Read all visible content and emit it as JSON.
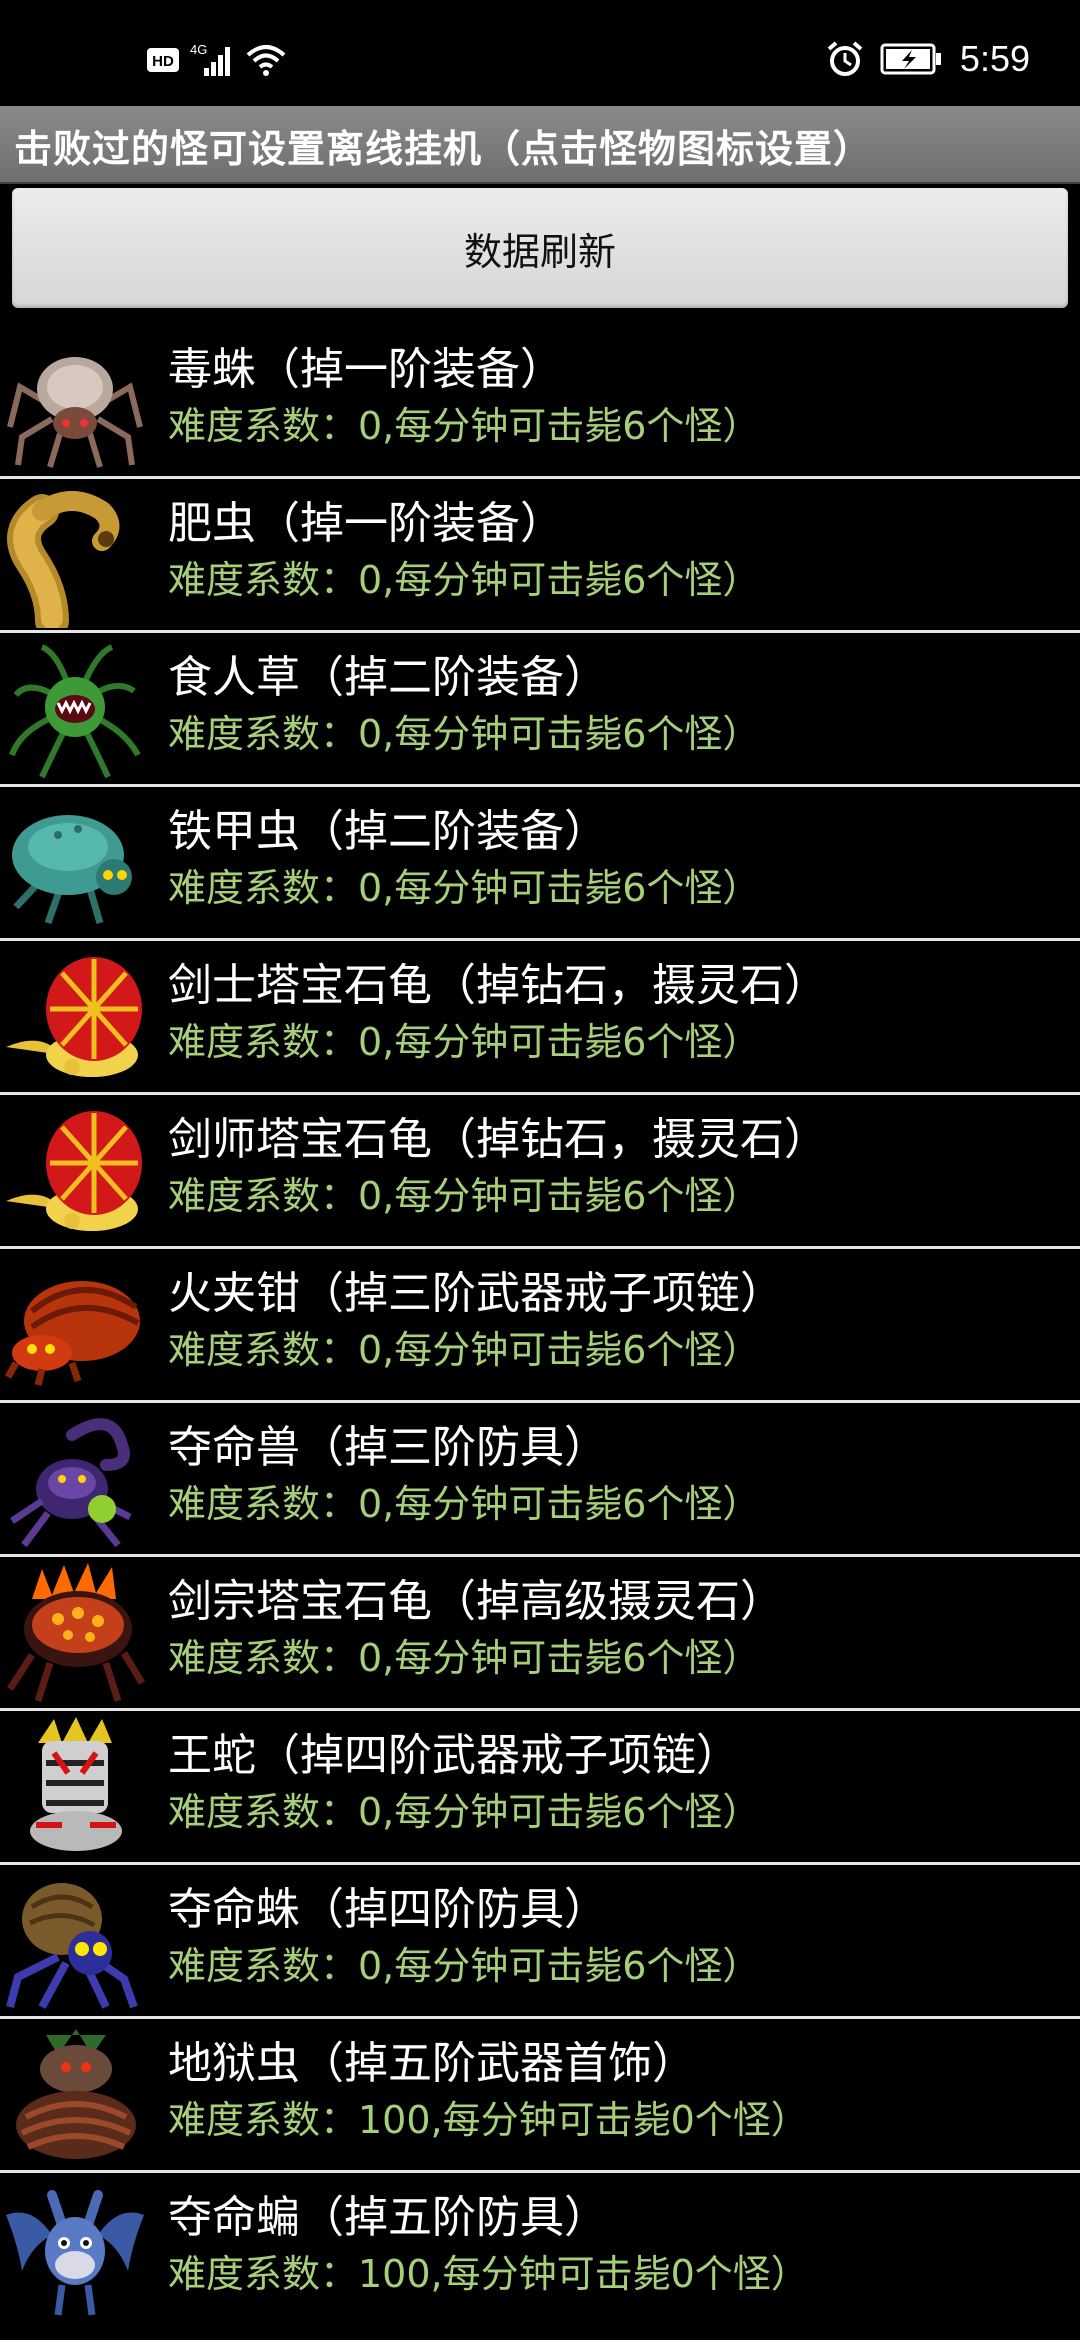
{
  "status_bar": {
    "left_icons": [
      "hd-icon",
      "4g-signal-icon",
      "wifi-icon"
    ],
    "hd_label": "HD",
    "network_label": "4G",
    "right_icons": [
      "alarm-icon",
      "battery-charging-icon"
    ],
    "time": "5:59"
  },
  "title_bar": {
    "text": "击败过的怪可设置离线挂机（点击怪物图标设置）"
  },
  "refresh_button": {
    "label": "数据刷新"
  },
  "colors": {
    "subtitle": "#a6cf7a",
    "title_bar": "#7d7d7d",
    "row_divider": "#e5e5e5"
  },
  "monsters": [
    {
      "icon": "spider-monster-icon",
      "name": "毒蛛（掉一阶装备）",
      "detail": "难度系数：0,每分钟可击毙6个怪）"
    },
    {
      "icon": "worm-monster-icon",
      "name": "肥虫（掉一阶装备）",
      "detail": "难度系数：0,每分钟可击毙6个怪）"
    },
    {
      "icon": "maneater-plant-icon",
      "name": "食人草（掉二阶装备）",
      "detail": "难度系数：0,每分钟可击毙6个怪）"
    },
    {
      "icon": "iron-beetle-icon",
      "name": "铁甲虫（掉二阶装备）",
      "detail": "难度系数：0,每分钟可击毙6个怪）"
    },
    {
      "icon": "gem-turtle-icon",
      "name": "剑士塔宝石龟（掉钻石，摄灵石）",
      "detail": "难度系数：0,每分钟可击毙6个怪）"
    },
    {
      "icon": "gem-turtle-icon",
      "name": "剑师塔宝石龟（掉钻石，摄灵石）",
      "detail": "难度系数：0,每分钟可击毙6个怪）"
    },
    {
      "icon": "fire-pincer-icon",
      "name": "火夹钳（掉三阶武器戒子项链）",
      "detail": "难度系数：0,每分钟可击毙6个怪）"
    },
    {
      "icon": "scorpion-beast-icon",
      "name": "夺命兽（掉三阶防具）",
      "detail": "难度系数：0,每分钟可击毙6个怪）"
    },
    {
      "icon": "lava-turtle-icon",
      "name": "剑宗塔宝石龟（掉高级摄灵石）",
      "detail": "难度系数：0,每分钟可击毙6个怪）"
    },
    {
      "icon": "king-serpent-icon",
      "name": "王蛇（掉四阶武器戒子项链）",
      "detail": "难度系数：0,每分钟可击毙6个怪）"
    },
    {
      "icon": "death-spider-icon",
      "name": "夺命蛛（掉四阶防具）",
      "detail": "难度系数：0,每分钟可击毙6个怪）"
    },
    {
      "icon": "hell-worm-icon",
      "name": "地狱虫（掉五阶武器首饰）",
      "detail": "难度系数：100,每分钟可击毙0个怪）"
    },
    {
      "icon": "death-bat-icon",
      "name": "夺命蝙（掉五阶防具）",
      "detail": "难度系数：100,每分钟可击毙0个怪）"
    }
  ]
}
